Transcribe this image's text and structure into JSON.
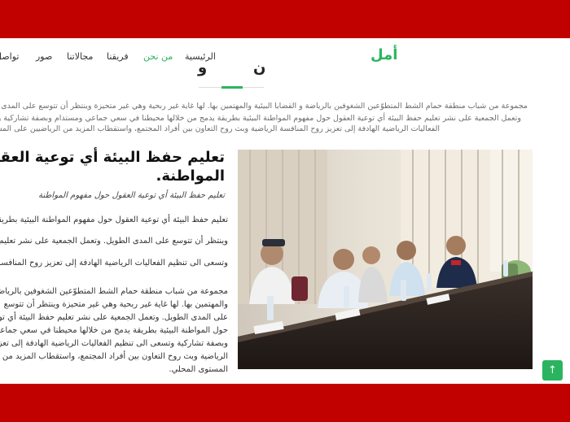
{
  "header": {
    "brand": "أمل",
    "nav": [
      "الرئيسية",
      "من نحن",
      "فريقنا",
      "مجالاتنا",
      "صور",
      "تواصل"
    ]
  },
  "section": {
    "title_fragment_left": "و",
    "title_fragment_right": "ن"
  },
  "intro_lines": [
    "مجموعة من شباب منطقة حمام الشط المتطوّعين الشغوفين بالرياضة و القضايا البيئية والمهتمين بها. لها غاية غير ربحية وهي غير متحيزة وينتظر أن تتوسع على المدى الطويل.",
    "وتعمل الجمعية على نشر تعليم حفظ البيئة أي توعية العقول حول مفهوم المواطنة البيئية بطريقة يدمج من خلالها محيطنا في سعي جماعي ومستدام وبصفة تشاركية وتسعى الى تنظيم",
    "الفعاليات الرياضية الهادفة إلى تعزيز روح المنافسة الرياضية وبث روح التعاون بين أفراد المجتمع، واستقطاب المزيد من الرياضيين على المستوى المحلي."
  ],
  "article": {
    "title_lines": [
      "تعليم حفظ البيئة أي توعية العقول حول",
      "المواطنة."
    ],
    "subtitle": "تعليم حفظ البيئة أي توعية العقول حول مفهوم المواطنة",
    "bullets": [
      "تعليم حفظ البيئة أي توعية العقول حول مفهوم المواطنة البيئية بطريقة",
      "وينتظر أن تتوسع على المدى الطويل. وتعمل الجمعية على نشر تعليم حفظ البيئة",
      "وتسعى الى تنظيم الفعاليات الرياضية الهادفة إلى تعزيز روح المنافسة الرياضية وبث روح"
    ],
    "paragraph": [
      "مجموعة من شباب منطقة حمام الشط المتطوّعين الشغوفين بالرياضة",
      "والمهتمين بها. لها غاية غير ربحية وهي غير متحيزة وينتظر أن تتوسع",
      "على المدى الطويل. وتعمل الجمعية على نشر تعليم حفظ البيئة أي توعية العقول",
      "حول المواطنة البيئية بطريقة يدمج من خلالها محيطنا في سعي جماعي ومستدام",
      "وبصفة تشاركية وتسعى الى تنظيم الفعاليات الرياضية الهادفة إلى تعزيز روح المنافسة",
      "الرياضية وبث روح التعاون بين أفراد المجتمع، واستقطاب المزيد من الرياضيين على",
      "المستوى المحلي."
    ]
  },
  "colors": {
    "accent": "#2bb45f",
    "brand_red": "#c10000"
  },
  "back_to_top_icon": "arrow-up-icon"
}
